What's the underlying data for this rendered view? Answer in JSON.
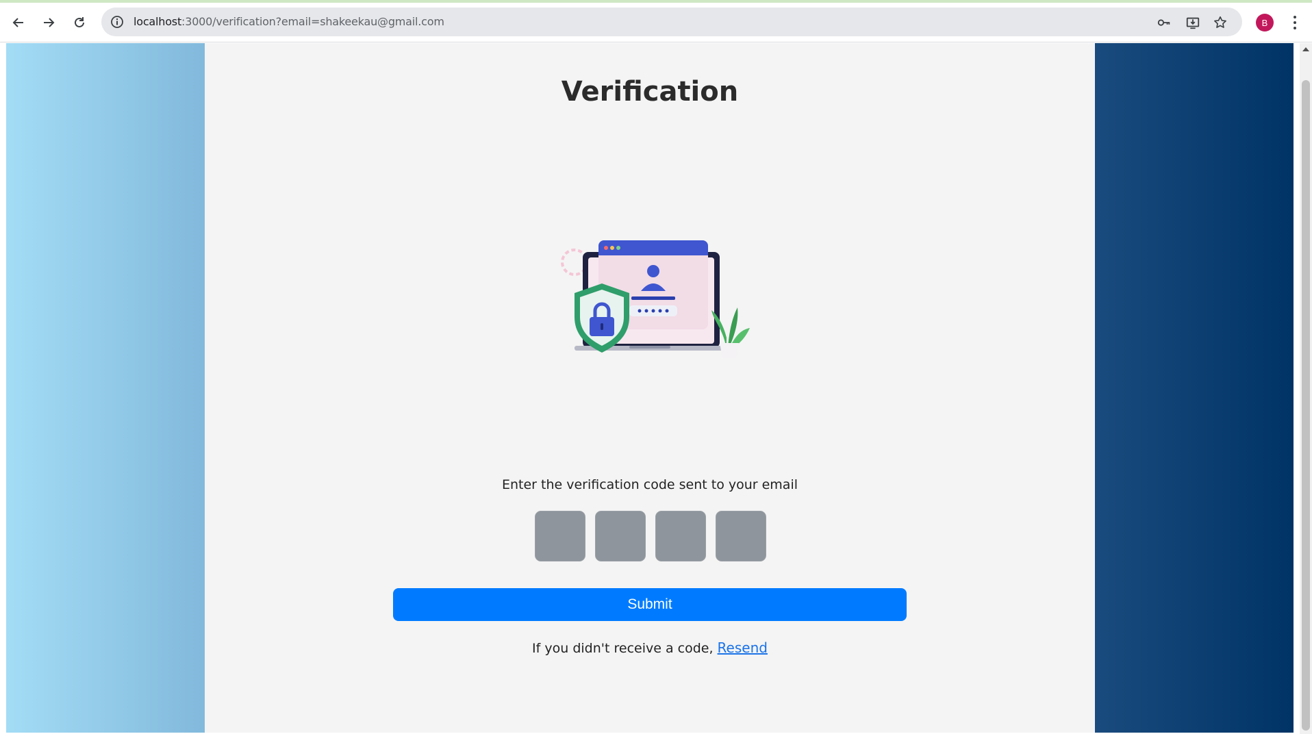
{
  "browser": {
    "url_host": "localhost",
    "url_rest": ":3000/verification?email=shakeekau@gmail.com",
    "profile_initial": "B",
    "icons": [
      "back-arrow-icon",
      "forward-arrow-icon",
      "reload-icon",
      "info-icon",
      "key-icon",
      "install-icon",
      "star-icon",
      "more-vert-icon"
    ]
  },
  "page": {
    "title": "Verification",
    "prompt": "Enter the verification code sent to your email",
    "code_length": 4,
    "submit_label": "Submit",
    "resend_prefix": "If you didn't receive a code,",
    "resend_link": "Resend"
  },
  "colors": {
    "submit_bg": "#007bff",
    "code_box_bg": "#8e959c",
    "left_gradient": [
      "#a3dcf5",
      "#82b9dc"
    ],
    "right_gradient": [
      "#1a4b7e",
      "#003366"
    ],
    "link": "#1a73e8",
    "avatar": "#c2185b"
  }
}
